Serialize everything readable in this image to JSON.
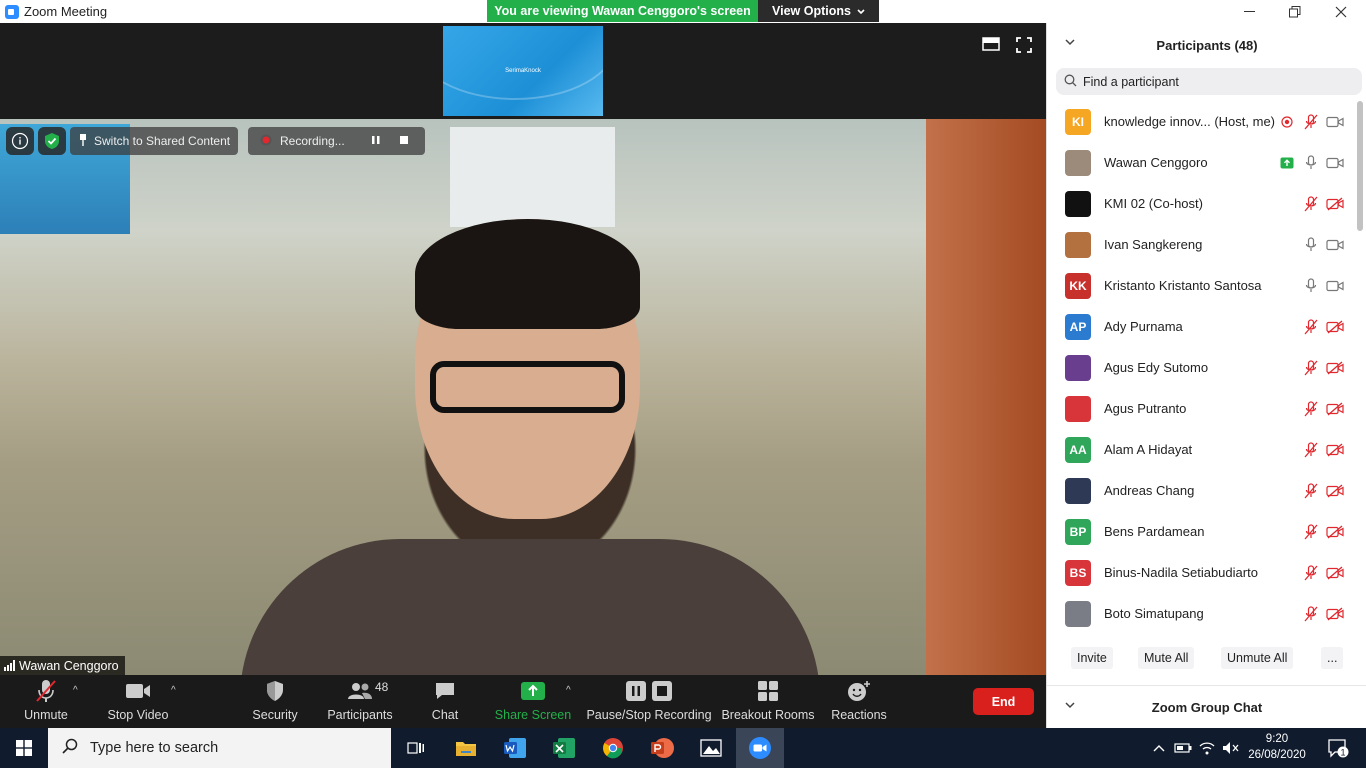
{
  "window": {
    "title": "Zoom Meeting"
  },
  "banner": {
    "viewing": "You are viewing Wawan Cenggoro's screen",
    "view_options": "View Options"
  },
  "shared_thumb": {
    "label": "SerimaKnock"
  },
  "video": {
    "speaker_name": "Wawan Cenggoro",
    "switch_label": "Switch to Shared Content",
    "recording_label": "Recording..."
  },
  "toolbar": {
    "unmute": "Unmute",
    "stop_video": "Stop Video",
    "security": "Security",
    "participants": "Participants",
    "participants_count": "48",
    "chat": "Chat",
    "share_screen": "Share Screen",
    "pause_stop_recording": "Pause/Stop Recording",
    "breakout_rooms": "Breakout Rooms",
    "reactions": "Reactions",
    "end": "End"
  },
  "panel": {
    "title": "Participants (48)",
    "search_placeholder": "Find a participant",
    "participants": [
      {
        "name": "knowledge innov... (Host, me)",
        "initials": "KI",
        "color": "#f5a623",
        "mic": "muted",
        "video": "on",
        "extra": "record"
      },
      {
        "name": "Wawan Cenggoro",
        "initials": "",
        "color": "#9c8a7a",
        "mic": "on",
        "video": "on",
        "extra": "share"
      },
      {
        "name": "KMI 02 (Co-host)",
        "initials": "",
        "color": "#111111",
        "mic": "muted",
        "video": "off",
        "extra": ""
      },
      {
        "name": "Ivan Sangkereng",
        "initials": "",
        "color": "#b3713f",
        "mic": "on",
        "video": "on",
        "extra": ""
      },
      {
        "name": "Kristanto Kristanto Santosa",
        "initials": "KK",
        "color": "#c8302c",
        "mic": "on",
        "video": "on",
        "extra": ""
      },
      {
        "name": "Ady Purnama",
        "initials": "AP",
        "color": "#2b7bd1",
        "mic": "muted",
        "video": "off",
        "extra": ""
      },
      {
        "name": "Agus Edy Sutomo",
        "initials": "",
        "color": "#6a3e8f",
        "mic": "muted",
        "video": "off",
        "extra": ""
      },
      {
        "name": "Agus Putranto",
        "initials": "",
        "color": "#d8353a",
        "mic": "muted",
        "video": "off",
        "extra": ""
      },
      {
        "name": "Alam A Hidayat",
        "initials": "AA",
        "color": "#2fa65a",
        "mic": "muted",
        "video": "off",
        "extra": ""
      },
      {
        "name": "Andreas Chang",
        "initials": "",
        "color": "#2e3a55",
        "mic": "muted",
        "video": "off",
        "extra": ""
      },
      {
        "name": "Bens Pardamean",
        "initials": "BP",
        "color": "#2fa65a",
        "mic": "muted",
        "video": "off",
        "extra": ""
      },
      {
        "name": "Binus-Nadila Setiabudiarto",
        "initials": "BS",
        "color": "#d8353a",
        "mic": "muted",
        "video": "off",
        "extra": ""
      },
      {
        "name": "Boto Simatupang",
        "initials": "",
        "color": "#7a7c86",
        "mic": "muted",
        "video": "off",
        "extra": ""
      }
    ],
    "invite": "Invite",
    "mute_all": "Mute All",
    "unmute_all": "Unmute All",
    "more": "...",
    "chat_title": "Zoom Group Chat"
  },
  "taskbar": {
    "search_placeholder": "Type here to search",
    "time": "9:20",
    "date": "26/08/2020",
    "notifications": "1"
  }
}
